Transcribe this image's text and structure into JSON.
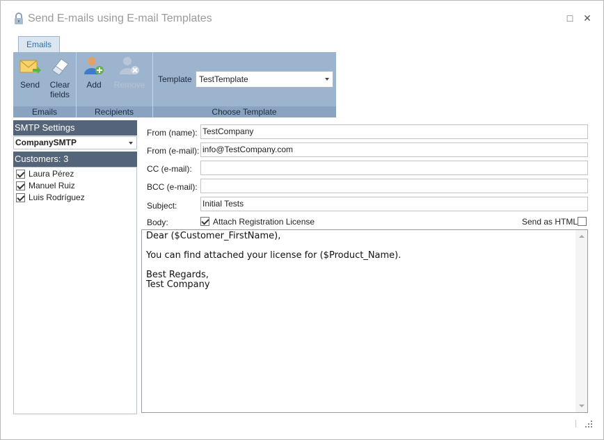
{
  "window": {
    "title": "Send E-mails using E-mail Templates",
    "maximize_glyph": "□",
    "close_glyph": "✕"
  },
  "ribbon": {
    "tab_label": "Emails",
    "buttons": {
      "send": "Send",
      "clear_line1": "Clear",
      "clear_line2": "fields",
      "add": "Add",
      "remove": "Remove"
    },
    "groups": {
      "emails": "Emails",
      "recipients": "Recipients",
      "choose_template": "Choose Template"
    },
    "template_label": "Template",
    "template_value": "TestTemplate"
  },
  "left_panel": {
    "smtp_header": "SMTP Settings",
    "smtp_value": "CompanySMTP",
    "customers_header": "Customers: 3",
    "customers": [
      {
        "name": "Laura Pérez",
        "checked": true
      },
      {
        "name": "Manuel Ruiz",
        "checked": true
      },
      {
        "name": "Luis Rodríguez",
        "checked": true
      }
    ]
  },
  "form": {
    "from_name_label": "From (name):",
    "from_name_value": "TestCompany",
    "from_email_label": "From (e-mail):",
    "from_email_value": "info@TestCompany.com",
    "cc_label": "CC (e-mail):",
    "cc_value": "",
    "bcc_label": "BCC (e-mail):",
    "bcc_value": "",
    "subject_label": "Subject:",
    "subject_value": "Initial Tests",
    "body_label": "Body:",
    "attach_label": "Attach Registration License",
    "attach_checked": true,
    "send_html_label": "Send as HTML",
    "send_html_checked": false,
    "body_text": "Dear ($Customer_FirstName),\n\nYou can find attached your license for ($Product_Name).\n\nBest Regards,\nTest Company"
  },
  "icons": {
    "title": "lock-icon",
    "send": "envelope-send-icon",
    "clear": "eraser-icon",
    "add": "add-user-icon",
    "remove": "remove-user-icon"
  },
  "colors": {
    "ribbon_bg": "#9db4cf",
    "panel_header_bg": "#54657a",
    "tab_text": "#2a6fb0"
  }
}
